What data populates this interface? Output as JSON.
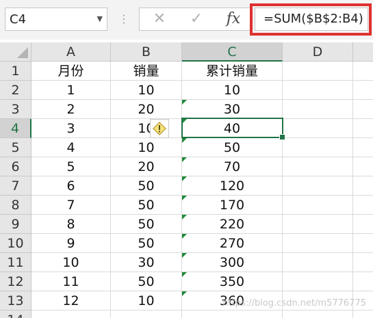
{
  "formula_bar": {
    "name_box": "C4",
    "separator": "⋮",
    "cancel_icon": "✕",
    "enter_icon": "✓",
    "fx_label": "fx",
    "formula": "=SUM($B$2:B4)"
  },
  "columns": [
    "A",
    "B",
    "C",
    "D"
  ],
  "row_numbers": [
    "1",
    "2",
    "3",
    "4",
    "5",
    "6",
    "7",
    "8",
    "9",
    "10",
    "11",
    "12",
    "13",
    "14"
  ],
  "rows": [
    [
      "月份",
      "销量",
      "累计销量",
      ""
    ],
    [
      "1",
      "10",
      "10",
      ""
    ],
    [
      "2",
      "20",
      "30",
      ""
    ],
    [
      "3",
      "10",
      "40",
      ""
    ],
    [
      "4",
      "10",
      "50",
      ""
    ],
    [
      "5",
      "20",
      "70",
      ""
    ],
    [
      "6",
      "50",
      "120",
      ""
    ],
    [
      "7",
      "50",
      "170",
      ""
    ],
    [
      "8",
      "50",
      "220",
      ""
    ],
    [
      "9",
      "50",
      "270",
      ""
    ],
    [
      "10",
      "30",
      "300",
      ""
    ],
    [
      "11",
      "50",
      "350",
      ""
    ],
    [
      "12",
      "10",
      "360",
      ""
    ],
    [
      "",
      "",
      "",
      ""
    ]
  ],
  "error_indicator_rows": [
    3,
    4,
    5,
    6,
    7,
    8,
    9,
    10,
    11,
    12,
    13
  ],
  "active_cell": "C4",
  "watermark": "https://blog.csdn.net/m5776775",
  "colors": {
    "accent": "#217346",
    "error_triangle": "#1e8a3a",
    "highlight_box": "#e03030"
  }
}
